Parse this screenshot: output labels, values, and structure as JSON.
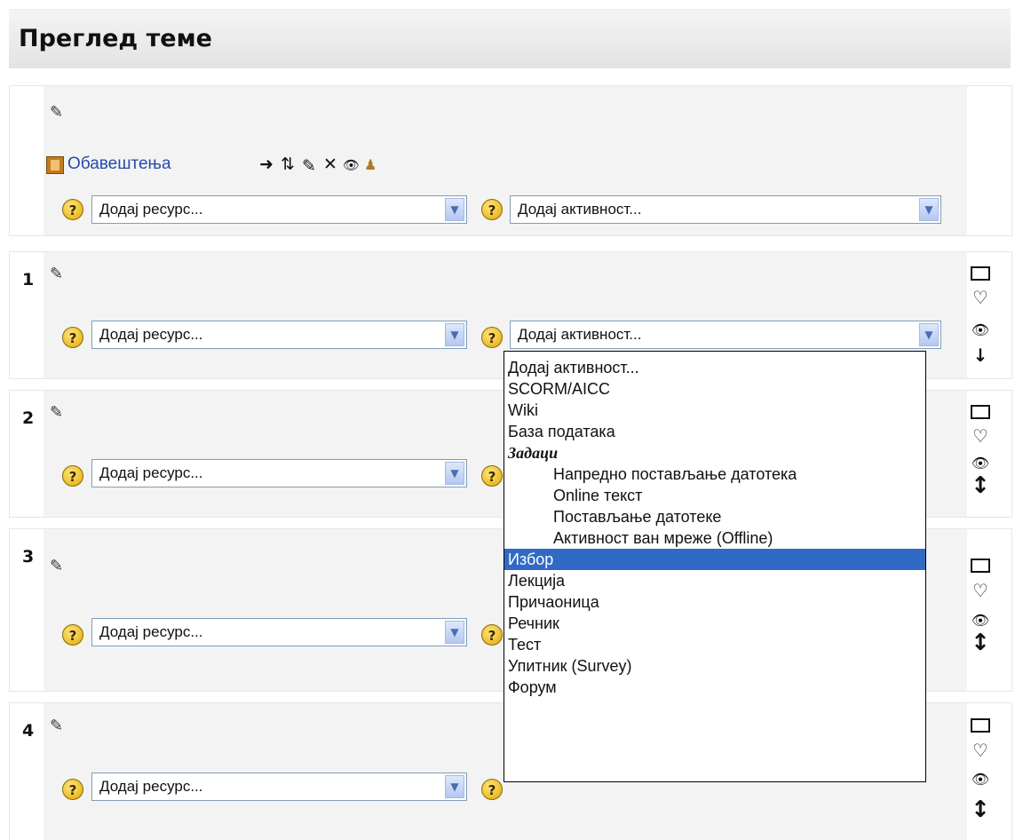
{
  "page": {
    "title": "Преглед теме"
  },
  "intro": {
    "news_link": "Обавештења",
    "add_resource": "Додај ресурс...",
    "add_activity": "Додај активност..."
  },
  "sections": [
    {
      "number": "1",
      "add_resource": "Додај ресурс...",
      "add_activity": "Додај активност..."
    },
    {
      "number": "2",
      "add_resource": "Додај ресурс..."
    },
    {
      "number": "3",
      "add_resource": "Додај ресурс..."
    },
    {
      "number": "4",
      "add_resource": "Додај ресурс..."
    }
  ],
  "help_symbol": "?",
  "activity_dropdown": {
    "items": [
      {
        "label": "Додај активност..."
      },
      {
        "label": "SCORM/AICC"
      },
      {
        "label": "Wiki"
      },
      {
        "label": "База података"
      },
      {
        "label": "Задаци"
      },
      {
        "label": "Напредно постављање датотека"
      },
      {
        "label": "Online текст"
      },
      {
        "label": "Постављање датотеке"
      },
      {
        "label": "Активност ван мреже (Offline)"
      },
      {
        "label": "Избор"
      },
      {
        "label": "Лекција"
      },
      {
        "label": "Причаоница"
      },
      {
        "label": "Речник"
      },
      {
        "label": "Тест"
      },
      {
        "label": "Упитник (Survey)"
      },
      {
        "label": "Форум"
      }
    ],
    "selected_index": 9
  },
  "icons": {
    "edit": "pencil-icon",
    "move_right": "arrow-right-icon",
    "move": "move-icon",
    "delete": "cross-icon",
    "hide": "eye-icon",
    "roles": "person-icon",
    "highlight": "lightbulb-icon"
  },
  "colors": {
    "link": "#2a4aa8",
    "selected_bg": "#316ac5",
    "select_border": "#7f9db9"
  }
}
